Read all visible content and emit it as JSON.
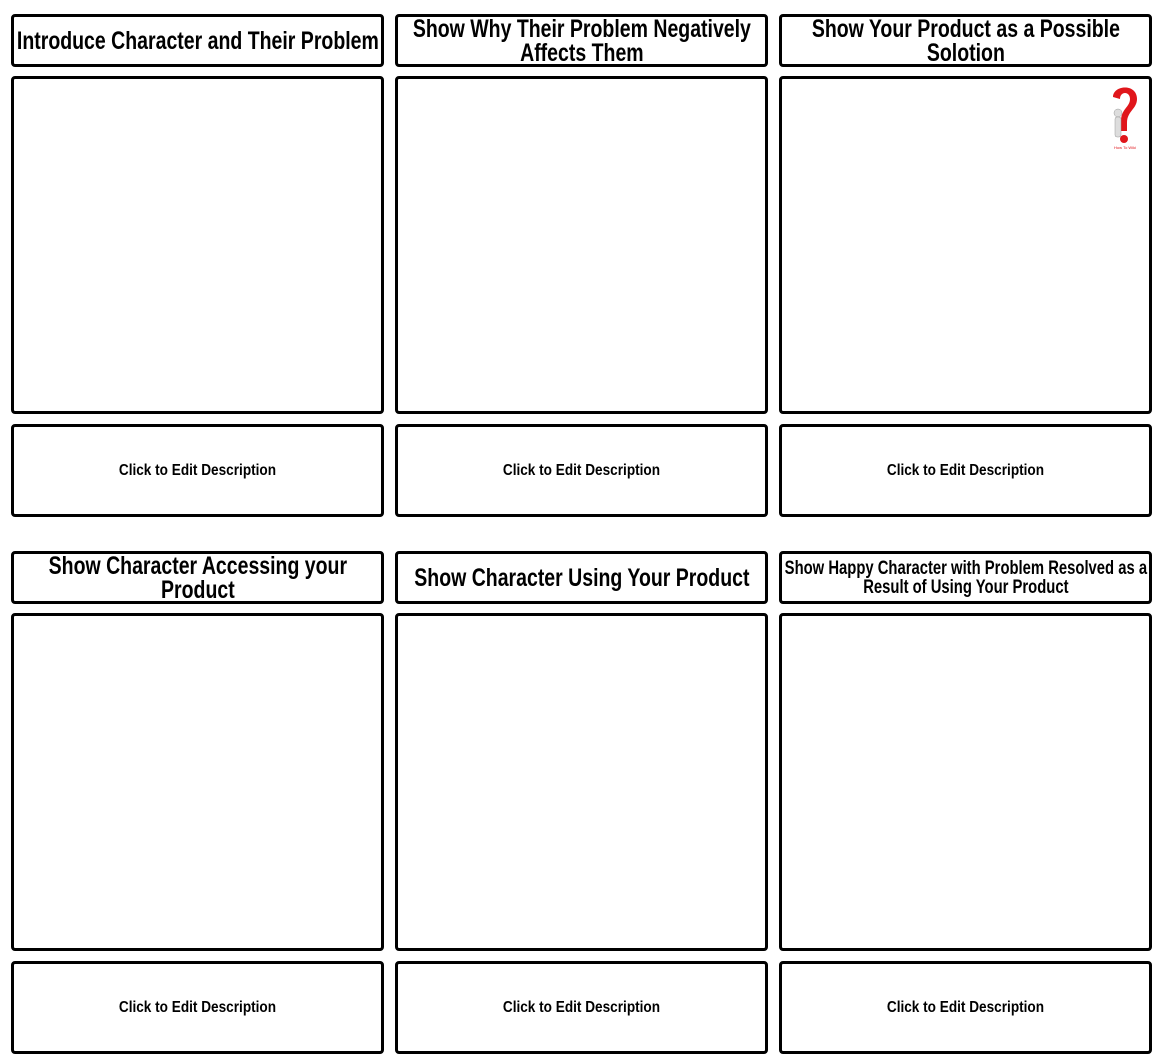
{
  "panels": [
    {
      "title": "Introduce Character and Their Problem",
      "description": "Click to Edit Description"
    },
    {
      "title": "Show Why Their Problem Negatively Affects Them",
      "description": "Click to Edit Description"
    },
    {
      "title": "Show Your Product as a Possible Solotion",
      "description": "Click to Edit Description"
    },
    {
      "title": "Show Character Accessing your Product",
      "description": "Click to Edit Description"
    },
    {
      "title": "Show Character Using Your Product",
      "description": "Click to Edit Description"
    },
    {
      "title": "Show Happy Character with Problem Resolved as a Result of Using Your Product",
      "description": "Click to Edit Description"
    }
  ],
  "watermark": {
    "text": "How To Wiki",
    "color": "#e0161b"
  }
}
